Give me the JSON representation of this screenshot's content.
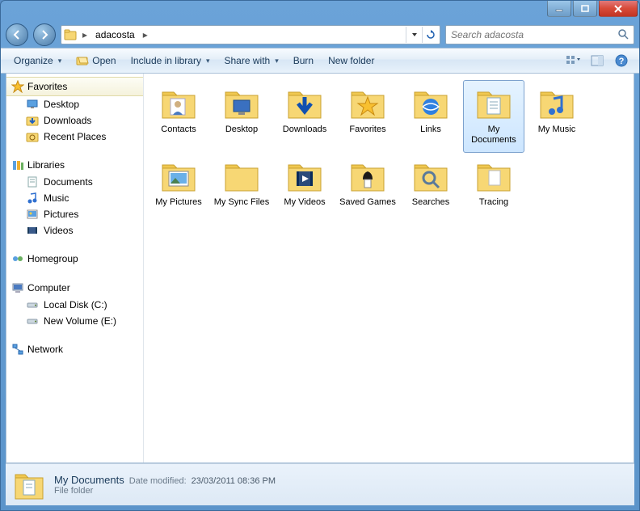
{
  "breadcrumb": {
    "current": "adacosta"
  },
  "search": {
    "placeholder": "Search adacosta"
  },
  "toolbar": {
    "organize": "Organize",
    "open": "Open",
    "include": "Include in library",
    "share": "Share with",
    "burn": "Burn",
    "newfolder": "New folder"
  },
  "nav": {
    "favorites": "Favorites",
    "desktop": "Desktop",
    "downloads": "Downloads",
    "recent": "Recent Places",
    "libraries": "Libraries",
    "documents": "Documents",
    "music": "Music",
    "pictures": "Pictures",
    "videos": "Videos",
    "homegroup": "Homegroup",
    "computer": "Computer",
    "localc": "Local Disk (C:)",
    "vole": "New Volume (E:)",
    "network": "Network"
  },
  "items": {
    "contacts": "Contacts",
    "desktop": "Desktop",
    "downloads": "Downloads",
    "favorites": "Favorites",
    "links": "Links",
    "mydocs": "My Documents",
    "mymusic": "My Music",
    "mypics": "My Pictures",
    "mysync": "My Sync Files",
    "myvideos": "My Videos",
    "savedgames": "Saved Games",
    "searches": "Searches",
    "tracing": "Tracing"
  },
  "details": {
    "name": "My Documents",
    "modlabel": "Date modified:",
    "modvalue": "23/03/2011 08:36 PM",
    "type": "File folder"
  }
}
